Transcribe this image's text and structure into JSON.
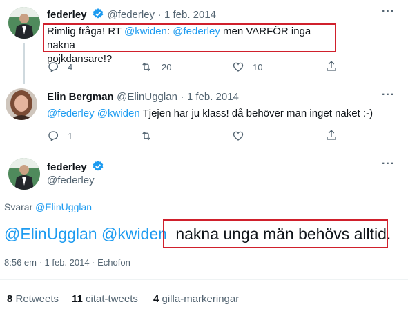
{
  "tweet1": {
    "name": "federley",
    "handle": "@federley",
    "separator": "·",
    "date": "1 feb. 2014",
    "text_prefix": "Rimlig fråga! RT ",
    "mention1": "@kwiden",
    "text_mid": ": ",
    "mention2": "@federley",
    "text_rest": " men VARFÖR inga nakna",
    "text_line2": "pojkdansare!?",
    "reply_count": "4",
    "retweet_count": "20",
    "like_count": "10",
    "more": "···"
  },
  "tweet2": {
    "name": "Elin Bergman",
    "handle": "@ElinUgglan",
    "separator": "·",
    "date": "1 feb. 2014",
    "mention1": "@federley",
    "mention2": "@kwiden",
    "text": " Tjejen har ju klass! då behöver man inget naket :-)",
    "reply_count": "1",
    "more": "···"
  },
  "main_tweet": {
    "name": "federley",
    "handle": "@federley",
    "replying_prefix": "Svarar ",
    "replying_to": "@ElinUgglan",
    "mention1": "@ElinUgglan",
    "mention2": "@kwiden",
    "text": "nakna unga män behövs alltid.",
    "timestamp": "8:56 em · 1 feb. 2014 · Echofon",
    "more": "···"
  },
  "stats": {
    "retweets_count": "8",
    "retweets_label": " Retweets",
    "quotes_count": "11",
    "quotes_label": " citat-tweets",
    "likes_count": "4",
    "likes_label": " gilla-markeringar"
  },
  "icons": [
    "reply-icon",
    "retweet-icon",
    "like-icon",
    "share-icon",
    "verified-badge-icon"
  ],
  "colors": {
    "link": "#1d9bf0",
    "muted": "#536471",
    "highlight_box": "#d0202c",
    "verified": "#1d9bf0"
  }
}
